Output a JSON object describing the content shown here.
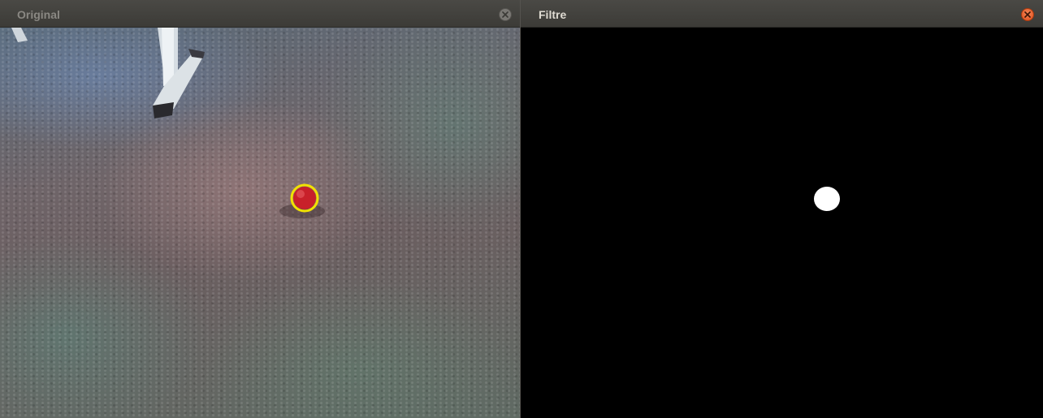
{
  "windows": {
    "original": {
      "title": "Original",
      "close_icon": "close-icon",
      "close_color": "#7a7874"
    },
    "filtre": {
      "title": "Filtre",
      "close_icon": "close-icon",
      "close_color": "#df4a16"
    }
  },
  "scene": {
    "ball_color": "#c8202a",
    "detection_circle_color": "#f2e100",
    "mask_background": "#000000",
    "mask_blob_color": "#ffffff"
  }
}
